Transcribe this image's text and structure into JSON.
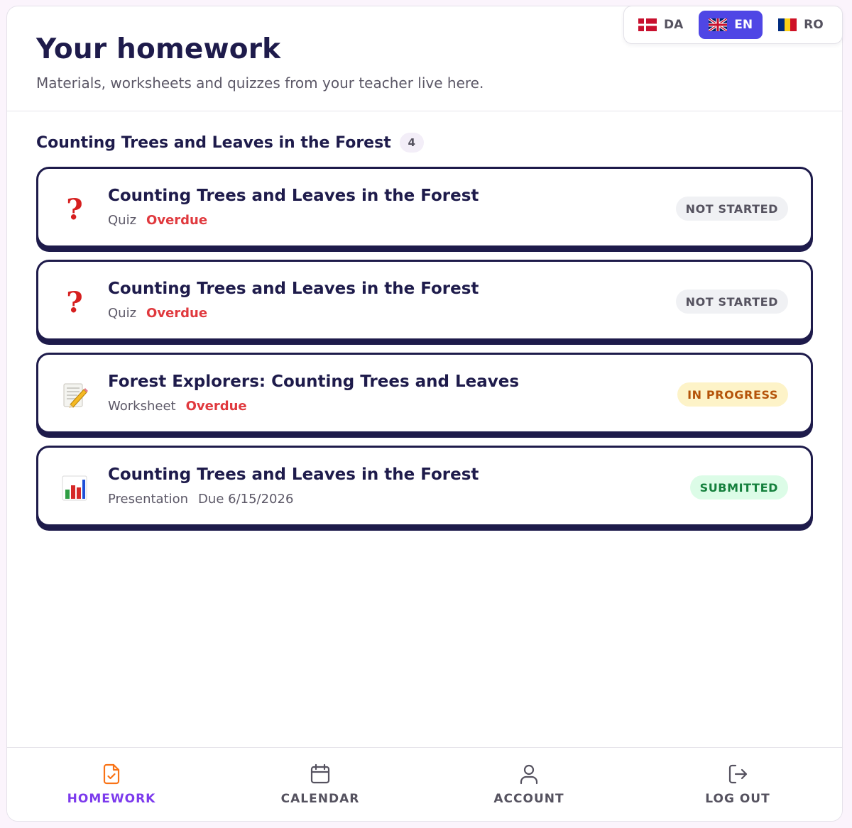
{
  "languages": [
    {
      "code": "DA",
      "flag": "denmark-flag",
      "active": false
    },
    {
      "code": "EN",
      "flag": "uk-flag",
      "active": true
    },
    {
      "code": "RO",
      "flag": "romania-flag",
      "active": false
    }
  ],
  "header": {
    "title": "Your homework",
    "subtitle": "Materials, worksheets and quizzes from your teacher live here."
  },
  "section": {
    "title": "Counting Trees and Leaves in the Forest",
    "count": "4"
  },
  "assignments": [
    {
      "icon": "question-mark-icon",
      "title": "Counting Trees and Leaves in the Forest",
      "type": "Quiz",
      "due": "Overdue",
      "overdue": true,
      "status": "NOT STARTED"
    },
    {
      "icon": "question-mark-icon",
      "title": "Counting Trees and Leaves in the Forest",
      "type": "Quiz",
      "due": "Overdue",
      "overdue": true,
      "status": "NOT STARTED"
    },
    {
      "icon": "memo-pencil-icon",
      "title": "Forest Explorers: Counting Trees and Leaves",
      "type": "Worksheet",
      "due": "Overdue",
      "overdue": true,
      "status": "IN PROGRESS"
    },
    {
      "icon": "bar-chart-icon",
      "title": "Counting Trees and Leaves in the Forest",
      "type": "Presentation",
      "due": "Due 6/15/2026",
      "overdue": false,
      "status": "SUBMITTED"
    }
  ],
  "nav": {
    "homework": "HOMEWORK",
    "calendar": "CALENDAR",
    "account": "ACCOUNT",
    "logout": "LOG OUT"
  },
  "colors": {
    "accent": "#4f46e5",
    "nav_active": "#7c3aed",
    "overdue": "#e0393e",
    "ink": "#1e1b4b"
  }
}
